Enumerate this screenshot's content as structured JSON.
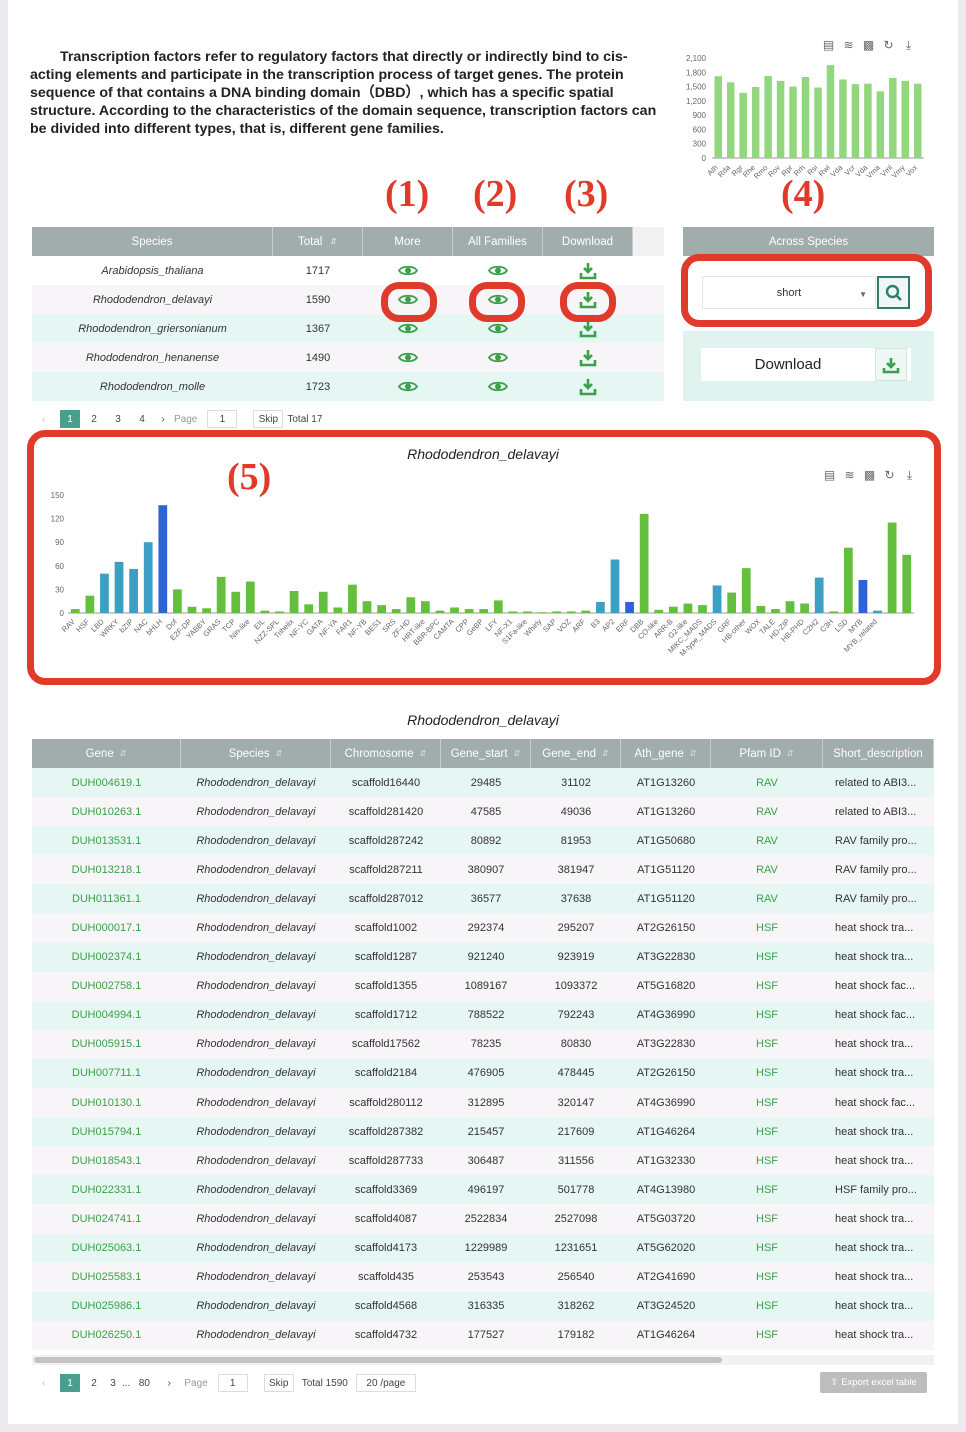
{
  "intro_text": "Transcription factors refer to regulatory factors that directly or indirectly bind to cis-acting elements and participate in the transcription process of target genes. The protein sequence of that contains a DNA binding domain（DBD）, which has a specific spatial structure. According to the characteristics of the domain sequence, transcription factors can be divided into different types, that is, different gene families.",
  "markers": {
    "m1": "(1)",
    "m2": "(2)",
    "m3": "(3)",
    "m4": "(4)",
    "m5": "(5)"
  },
  "species_table": {
    "headers": {
      "species": "Species",
      "total": "Total",
      "more": "More",
      "all_families": "All Families",
      "download": "Download"
    },
    "rows": [
      {
        "species": "Arabidopsis_thaliana",
        "total": "1717"
      },
      {
        "species": "Rhododendron_delavayi",
        "total": "1590"
      },
      {
        "species": "Rhododendron_griersonianum",
        "total": "1367"
      },
      {
        "species": "Rhododendron_henanense",
        "total": "1490"
      },
      {
        "species": "Rhododendron_molle",
        "total": "1723"
      }
    ],
    "pager": {
      "pages": [
        "1",
        "2",
        "3",
        "4"
      ],
      "page_label": "Page",
      "page_value": "1",
      "skip": "Skip",
      "total": "Total 17"
    }
  },
  "across": {
    "header": "Across Species",
    "select_value": "short",
    "download_label": "Download"
  },
  "colors": {
    "header_bg": "#a1acac",
    "accent": "#2e7d6e",
    "bar_green": "#65bf3e",
    "bar_teal": "#3ba0c4",
    "bar_blue": "#2e63d7",
    "marker_red": "#e03a2b",
    "gene_green": "#3aa14a"
  },
  "chart_data": [
    {
      "type": "bar",
      "categories": [
        "Ath",
        "Rda",
        "Rgr",
        "Rhe",
        "Rmo",
        "Rov",
        "Rpr",
        "Rrh",
        "Rsi",
        "Rwi",
        "Vda",
        "Vcr",
        "Vda",
        "Vma",
        "Vml",
        "Vmy",
        "Vox"
      ],
      "values": [
        1717,
        1590,
        1367,
        1490,
        1723,
        1620,
        1500,
        1700,
        1480,
        1950,
        1650,
        1550,
        1560,
        1400,
        1680,
        1620,
        1560
      ],
      "ylim": [
        0,
        2100
      ],
      "yticks": [
        "2,100",
        "1,800",
        "1,500",
        "1,200",
        "900",
        "600",
        "300",
        "0"
      ]
    },
    {
      "type": "bar",
      "title": "Rhododendron_delavayi",
      "categories": [
        "RAV",
        "HSF",
        "LBD",
        "WRKY",
        "bZIP",
        "NAC",
        "bHLH",
        "Dof",
        "E2F-DP",
        "YABBY",
        "GRAS",
        "TCP",
        "Nin-like",
        "EIL",
        "NZZ-SPL",
        "Trihelix",
        "NF-YC",
        "GATA",
        "NF-YA",
        "FAR1",
        "NF-YB",
        "BES1",
        "SRS",
        "ZF-HD",
        "HRT-like",
        "BBR-BPC",
        "CAMTA",
        "CPP",
        "GeBP",
        "LFY",
        "NF-X1",
        "S1Fa-like",
        "Whirly",
        "SAP",
        "VOZ",
        "ARF",
        "B3",
        "AP2",
        "ERF",
        "DBB",
        "CO-like",
        "ARR-B",
        "G2-like",
        "MIKC_MADS",
        "M-type_MADS",
        "GRF",
        "HB-other",
        "WOX",
        "TALE",
        "HD-ZIP",
        "HB-PHD",
        "C2H2",
        "C3H",
        "LSD",
        "MYB",
        "MYB_related"
      ],
      "values": [
        5,
        22,
        50,
        65,
        56,
        90,
        137,
        30,
        8,
        6,
        46,
        27,
        40,
        3,
        2,
        28,
        11,
        27,
        7,
        36,
        15,
        10,
        5,
        20,
        15,
        3,
        7,
        5,
        5,
        16,
        2,
        2,
        1,
        2,
        2,
        3,
        14,
        68,
        14,
        126,
        4,
        8,
        12,
        10,
        35,
        26,
        57,
        9,
        5,
        15,
        12,
        45,
        2,
        83,
        42,
        3,
        115,
        74
      ],
      "ylim": [
        0,
        150
      ],
      "yticks": [
        "150",
        "120",
        "90",
        "60",
        "30",
        "0"
      ]
    }
  ],
  "gene_table": {
    "title": "Rhododendron_delavayi",
    "headers": [
      "Gene",
      "Species",
      "Chromosome",
      "Gene_start",
      "Gene_end",
      "Ath_gene",
      "Pfam ID",
      "Short_description"
    ],
    "rows": [
      [
        "DUH004619.1",
        "Rhododendron_delavayi",
        "scaffold16440",
        "29485",
        "31102",
        "AT1G13260",
        "RAV",
        "related to ABI3..."
      ],
      [
        "DUH010263.1",
        "Rhododendron_delavayi",
        "scaffold281420",
        "47585",
        "49036",
        "AT1G13260",
        "RAV",
        "related to ABI3..."
      ],
      [
        "DUH013531.1",
        "Rhododendron_delavayi",
        "scaffold287242",
        "80892",
        "81953",
        "AT1G50680",
        "RAV",
        "RAV family pro..."
      ],
      [
        "DUH013218.1",
        "Rhododendron_delavayi",
        "scaffold287211",
        "380907",
        "381947",
        "AT1G51120",
        "RAV",
        "RAV family pro..."
      ],
      [
        "DUH011361.1",
        "Rhododendron_delavayi",
        "scaffold287012",
        "36577",
        "37638",
        "AT1G51120",
        "RAV",
        "RAV family pro..."
      ],
      [
        "DUH000017.1",
        "Rhododendron_delavayi",
        "scaffold1002",
        "292374",
        "295207",
        "AT2G26150",
        "HSF",
        "heat shock tra..."
      ],
      [
        "DUH002374.1",
        "Rhododendron_delavayi",
        "scaffold1287",
        "921240",
        "923919",
        "AT3G22830",
        "HSF",
        "heat shock tra..."
      ],
      [
        "DUH002758.1",
        "Rhododendron_delavayi",
        "scaffold1355",
        "1089167",
        "1093372",
        "AT5G16820",
        "HSF",
        "heat shock fac..."
      ],
      [
        "DUH004994.1",
        "Rhododendron_delavayi",
        "scaffold1712",
        "788522",
        "792243",
        "AT4G36990",
        "HSF",
        "heat shock fac..."
      ],
      [
        "DUH005915.1",
        "Rhododendron_delavayi",
        "scaffold17562",
        "78235",
        "80830",
        "AT3G22830",
        "HSF",
        "heat shock tra..."
      ],
      [
        "DUH007711.1",
        "Rhododendron_delavayi",
        "scaffold2184",
        "476905",
        "478445",
        "AT2G26150",
        "HSF",
        "heat shock tra..."
      ],
      [
        "DUH010130.1",
        "Rhododendron_delavayi",
        "scaffold280112",
        "312895",
        "320147",
        "AT4G36990",
        "HSF",
        "heat shock fac..."
      ],
      [
        "DUH015794.1",
        "Rhododendron_delavayi",
        "scaffold287382",
        "215457",
        "217609",
        "AT1G46264",
        "HSF",
        "heat shock tra..."
      ],
      [
        "DUH018543.1",
        "Rhododendron_delavayi",
        "scaffold287733",
        "306487",
        "311556",
        "AT1G32330",
        "HSF",
        "heat shock tra..."
      ],
      [
        "DUH022331.1",
        "Rhododendron_delavayi",
        "scaffold3369",
        "496197",
        "501778",
        "AT4G13980",
        "HSF",
        "HSF family pro..."
      ],
      [
        "DUH024741.1",
        "Rhododendron_delavayi",
        "scaffold4087",
        "2522834",
        "2527098",
        "AT5G03720",
        "HSF",
        "heat shock tra..."
      ],
      [
        "DUH025063.1",
        "Rhododendron_delavayi",
        "scaffold4173",
        "1229989",
        "1231651",
        "AT5G62020",
        "HSF",
        "heat shock tra..."
      ],
      [
        "DUH025583.1",
        "Rhododendron_delavayi",
        "scaffold435",
        "253543",
        "256540",
        "AT2G41690",
        "HSF",
        "heat shock tra..."
      ],
      [
        "DUH025986.1",
        "Rhododendron_delavayi",
        "scaffold4568",
        "316335",
        "318262",
        "AT3G24520",
        "HSF",
        "heat shock tra..."
      ],
      [
        "DUH026250.1",
        "Rhododendron_delavayi",
        "scaffold4732",
        "177527",
        "179182",
        "AT1G46264",
        "HSF",
        "heat shock tra..."
      ]
    ],
    "pager": {
      "pages": [
        "1",
        "2",
        "3"
      ],
      "ellipsis": "...",
      "last": "80",
      "page_label": "Page",
      "page_value": "1",
      "skip": "Skip",
      "total": "Total 1590",
      "per_page": "20 /page"
    },
    "export_label": "Export excel table"
  }
}
